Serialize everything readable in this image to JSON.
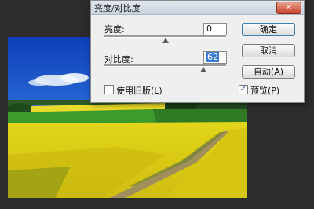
{
  "dialog": {
    "title": "亮度/对比度",
    "close_label": "✕",
    "brightness": {
      "label": "亮度:",
      "value": "0",
      "slider_position": 0.5
    },
    "contrast": {
      "label": "对比度:",
      "value": "62",
      "slider_position": 0.81
    },
    "buttons": {
      "ok": "确定",
      "cancel": "取消",
      "auto": "自动(A)"
    },
    "legacy_checkbox": {
      "label": "使用旧版(L)",
      "checked": false
    },
    "preview_checkbox": {
      "label": "预览(P)",
      "checked": true,
      "mark": "✓"
    }
  },
  "photo": {
    "description_colors": {
      "sky": "#1f5fd0",
      "field": "#e9dc1a",
      "grass": "#3d8a2a"
    }
  }
}
